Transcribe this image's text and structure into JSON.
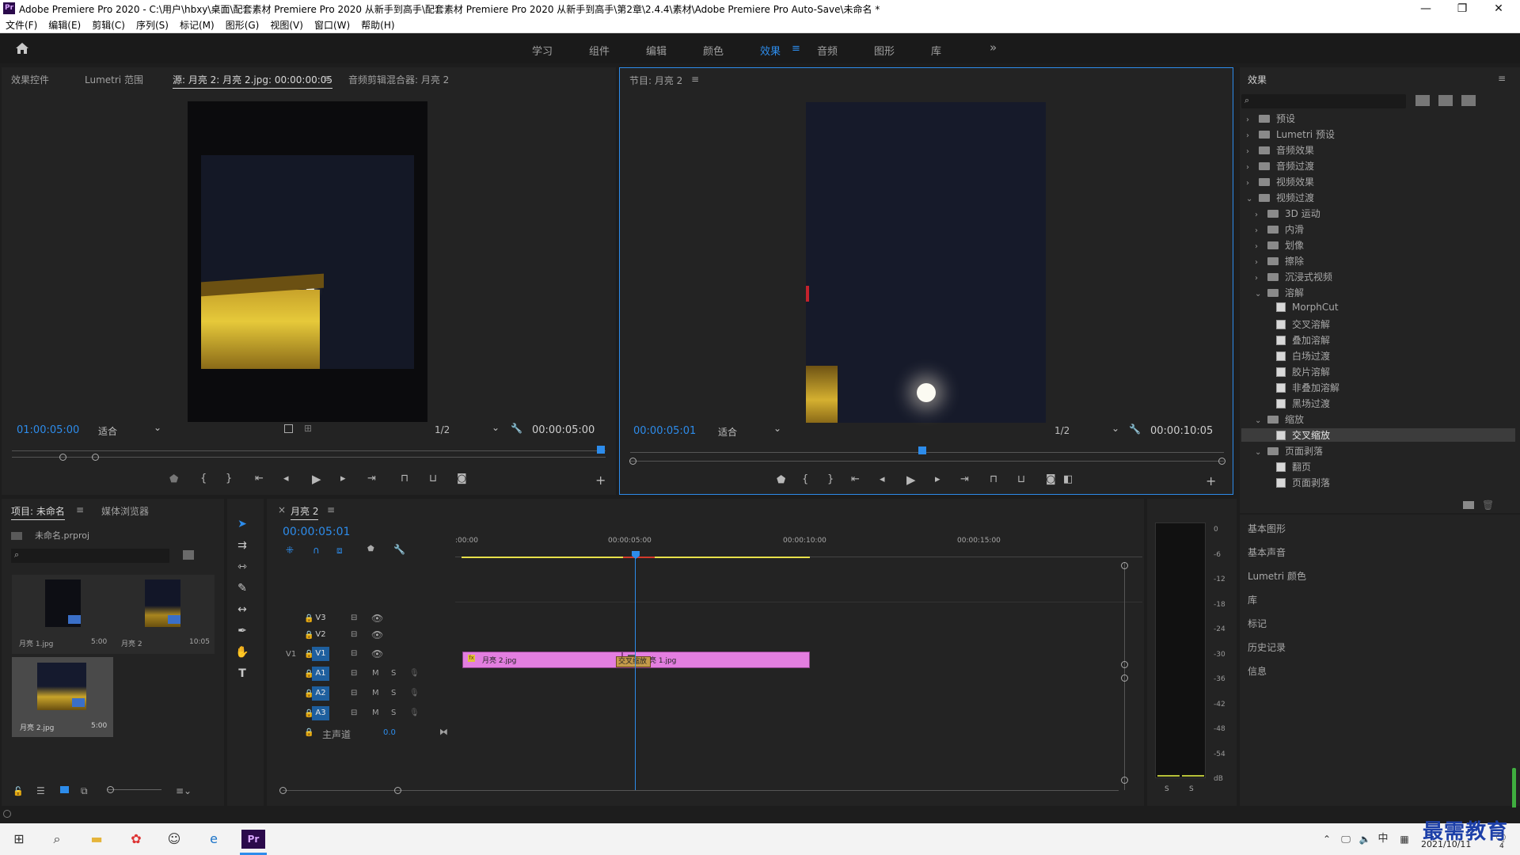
{
  "window": {
    "title": "Adobe Premiere Pro 2020 - C:\\用户\\hbxy\\桌面\\配套素材 Premiere Pro 2020 从新手到高手\\配套素材 Premiere Pro 2020 从新手到高手\\第2章\\2.4.4\\素材\\Adobe Premiere Pro Auto-Save\\未命名 *",
    "logo": "Pr",
    "minimize": "—",
    "restore": "❐",
    "close": "✕"
  },
  "menu": [
    "文件(F)",
    "编辑(E)",
    "剪辑(C)",
    "序列(S)",
    "标记(M)",
    "图形(G)",
    "视图(V)",
    "窗口(W)",
    "帮助(H)"
  ],
  "workspaces": {
    "items": [
      "学习",
      "组件",
      "编辑",
      "颜色",
      "效果",
      "音频",
      "图形",
      "库"
    ],
    "active": "效果",
    "menu_icon": "≡",
    "more": "»"
  },
  "source_panel": {
    "tabs": [
      "效果控件",
      "Lumetri 范围",
      "源: 月亮 2: 月亮 2.jpg: 00:00:00:05",
      "音频剪辑混合器: 月亮 2"
    ],
    "tab_menu": "≡",
    "timecode_left": "01:00:05:00",
    "fit": "适合",
    "resolution": "1/2",
    "timecode_right": "00:00:05:00"
  },
  "program_panel": {
    "tab": "节目: 月亮 2",
    "tab_menu": "≡",
    "timecode_left": "00:00:05:01",
    "fit": "适合",
    "resolution": "1/2",
    "timecode_right": "00:00:10:05"
  },
  "effects_panel": {
    "title": "效果",
    "menu": "≡",
    "tree": [
      {
        "label": "预设",
        "level": 0,
        "kind": "folder",
        "expanded": false
      },
      {
        "label": "Lumetri 预设",
        "level": 0,
        "kind": "folder",
        "expanded": false
      },
      {
        "label": "音频效果",
        "level": 0,
        "kind": "folder",
        "expanded": false
      },
      {
        "label": "音频过渡",
        "level": 0,
        "kind": "folder",
        "expanded": false
      },
      {
        "label": "视频效果",
        "level": 0,
        "kind": "folder",
        "expanded": false
      },
      {
        "label": "视频过渡",
        "level": 0,
        "kind": "folder",
        "expanded": true
      },
      {
        "label": "3D 运动",
        "level": 1,
        "kind": "folder",
        "expanded": false
      },
      {
        "label": "内滑",
        "level": 1,
        "kind": "folder",
        "expanded": false
      },
      {
        "label": "划像",
        "level": 1,
        "kind": "folder",
        "expanded": false
      },
      {
        "label": "擦除",
        "level": 1,
        "kind": "folder",
        "expanded": false
      },
      {
        "label": "沉浸式视频",
        "level": 1,
        "kind": "folder",
        "expanded": false
      },
      {
        "label": "溶解",
        "level": 1,
        "kind": "folder",
        "expanded": true
      },
      {
        "label": "MorphCut",
        "level": 2,
        "kind": "effect"
      },
      {
        "label": "交叉溶解",
        "level": 2,
        "kind": "effect"
      },
      {
        "label": "叠加溶解",
        "level": 2,
        "kind": "effect"
      },
      {
        "label": "白场过渡",
        "level": 2,
        "kind": "effect"
      },
      {
        "label": "胶片溶解",
        "level": 2,
        "kind": "effect"
      },
      {
        "label": "非叠加溶解",
        "level": 2,
        "kind": "effect"
      },
      {
        "label": "黑场过渡",
        "level": 2,
        "kind": "effect"
      },
      {
        "label": "缩放",
        "level": 1,
        "kind": "folder",
        "expanded": true
      },
      {
        "label": "交叉缩放",
        "level": 2,
        "kind": "effect",
        "selected": true
      },
      {
        "label": "页面剥落",
        "level": 1,
        "kind": "folder",
        "expanded": true
      },
      {
        "label": "翻页",
        "level": 2,
        "kind": "effect"
      },
      {
        "label": "页面剥落",
        "level": 2,
        "kind": "effect"
      }
    ],
    "side_panels": [
      "基本图形",
      "基本声音",
      "Lumetri 颜色",
      "库",
      "标记",
      "历史记录",
      "信息"
    ]
  },
  "project_panel": {
    "tabs": [
      "项目: 未命名",
      "媒体浏览器"
    ],
    "tab_menu": "≡",
    "project_file": "未命名.prproj",
    "items": [
      {
        "name": "月亮 1.jpg",
        "duration": "5:00"
      },
      {
        "name": "月亮 2",
        "duration": "10:05"
      },
      {
        "name": "月亮 2.jpg",
        "duration": "5:00"
      }
    ]
  },
  "timeline": {
    "tab": "月亮 2",
    "close": "×",
    "tab_menu": "≡",
    "timecode": "00:00:05:01",
    "ruler": [
      ":00:00",
      "00:00:05:00",
      "00:00:10:00",
      "00:00:15:00"
    ],
    "video_tracks": [
      "V3",
      "V2",
      "V1"
    ],
    "audio_tracks": [
      "A1",
      "A2",
      "A3"
    ],
    "source_patch": "V1",
    "master": {
      "label": "主声道",
      "value": "0.0"
    },
    "clips": [
      {
        "name": "月亮 2.jpg",
        "track": "V1"
      },
      {
        "name": "月亮 1.jpg",
        "track": "V1"
      }
    ],
    "transition": "交叉缩放",
    "mute": "M",
    "solo": "S"
  },
  "audio_meter": {
    "scale": [
      "0",
      "-6",
      "-12",
      "-18",
      "-24",
      "-30",
      "-36",
      "-42",
      "-48",
      "-54",
      "dB"
    ],
    "solo_left": "S",
    "solo_right": "S"
  },
  "taskbar": {
    "ime": "中",
    "date": "2021/10/11",
    "notify_count": "4"
  },
  "watermark": "最需教育",
  "colors": {
    "accent": "#2d8ceb",
    "clip": "#e37ee0",
    "transition": "#c49a4a",
    "playhead": "#2d8ceb",
    "work_area": "#e8e04a"
  }
}
